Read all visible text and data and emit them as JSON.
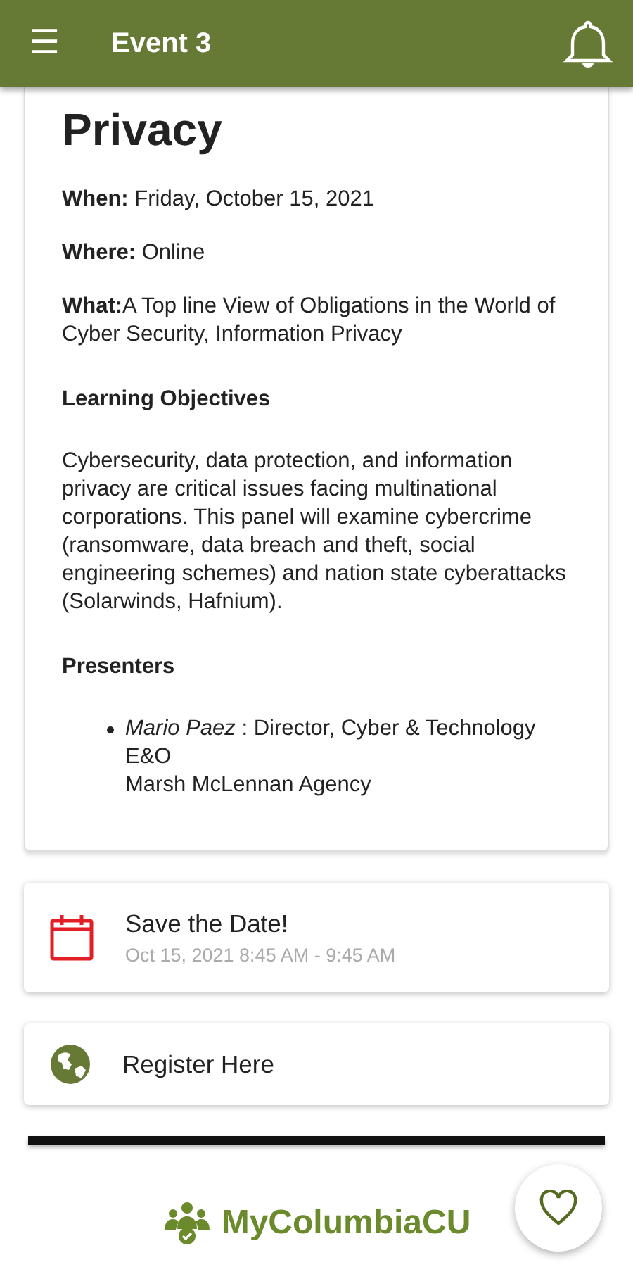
{
  "app_bar": {
    "menu_glyph": "☰",
    "title": "Event 3"
  },
  "event": {
    "title": "Privacy",
    "fields": [
      {
        "text": "**When:** Friday, October 15, 2021"
      },
      {
        "text": "**Where:** Online"
      },
      {
        "text": "**What:**A Top line View of Obligations in the World of Cyber Security, Information Privacy"
      }
    ],
    "objectives_heading": "Learning Objectives",
    "objectives": "Cybersecurity, data protection, and information privacy are critical issues facing multinational corporations. This panel will examine cybercrime (ransomware, data breach and theft, social engineering schemes) and nation state cyberattacks (Solarwinds, Hafnium).",
    "presenters_heading": "Presenters",
    "presenters": [
      {
        "lines": [
          "*Mario Paez* : Director, Cyber & Technology E&O",
          "Marsh McLennan Agency"
        ]
      }
    ]
  },
  "actions": [
    {
      "kind": "calendar",
      "title": "Save the Date!",
      "subtitle": "Oct 15, 2021 8:45 AM - 9:45 AM"
    },
    {
      "kind": "globe",
      "title": "Register Here"
    }
  ],
  "footer": {
    "brand": "MyColumbiaCU",
    "favorite": false
  }
}
